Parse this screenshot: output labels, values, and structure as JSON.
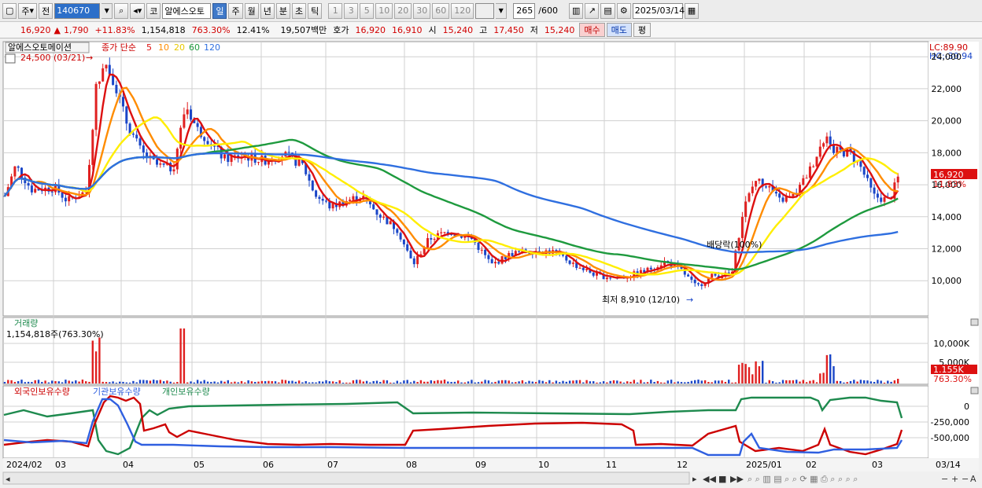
{
  "toolbar": {
    "type_label": "주",
    "prev_label": "전",
    "code": "140670",
    "market_label": "코",
    "stock_name": "알에스오토",
    "periods": [
      "일",
      "주",
      "월",
      "년",
      "분",
      "초",
      "틱"
    ],
    "active_period": "일",
    "intervals": [
      "1",
      "3",
      "5",
      "10",
      "20",
      "30",
      "60",
      "120"
    ],
    "count": "265",
    "count_total": "/600",
    "date": "2025/03/14"
  },
  "quote": {
    "price": "16,920",
    "change_arrow": "▲",
    "change": "1,790",
    "change_pct": "+11.83%",
    "volume": "1,154,818",
    "volume_ratio": "763.30%",
    "turnover_ratio": "12.41%",
    "trade_value": "19,507백만",
    "ask_label": "호가",
    "ask": "16,920",
    "bid": "16,910",
    "open_label": "시",
    "open": "15,240",
    "high_label": "고",
    "high": "17,450",
    "low_label": "저",
    "low": "15,240",
    "buy_label": "매수",
    "sell_label": "매도",
    "flat_label": "평"
  },
  "price_pane": {
    "stock_tag": "알에스오토메이션",
    "ma_title": "종가 단순",
    "ma_periods": [
      "5",
      "10",
      "20",
      "60",
      "120"
    ],
    "ma_colors": [
      "#dd1010",
      "#ff8c00",
      "#ffee00",
      "#1e9a3e",
      "#2f6fe0"
    ],
    "high_marker": "24,500 (03/21)",
    "low_marker": "최저 8,910 (12/10)",
    "dividend_marker": "배당락(100%)",
    "lc_label": "LC:89.90",
    "hc_label": "HC:-30.94",
    "current_price": "16,920",
    "current_change": "11.83%",
    "y_labels": [
      "24,000",
      "22,000",
      "20,000",
      "18,000",
      "16,000",
      "14,000",
      "12,000",
      "10,000"
    ]
  },
  "volume_pane": {
    "title": "거래량",
    "value": "1,154,818주(763.30%)",
    "current": "1.155K",
    "current_pct": "763.30%",
    "y_labels": [
      "10,000K",
      "5,000K"
    ]
  },
  "holding_pane": {
    "legend": [
      "외국인보유수량",
      "기관보유수량",
      "개인보유수량"
    ],
    "legend_colors": [
      "#cc0000",
      "#2f5fe0",
      "#1e8a4e"
    ],
    "y_labels": [
      "0",
      "-250,000",
      "-500,000"
    ]
  },
  "x_axis": {
    "labels": [
      "2024/02",
      "03",
      "04",
      "05",
      "06",
      "07",
      "08",
      "09",
      "10",
      "11",
      "12",
      "2025/01",
      "02",
      "03"
    ],
    "last_date": "03/14"
  },
  "colors": {
    "up": "#e02020",
    "down": "#1a46c8",
    "grid": "#d0d0d0",
    "active_tab": "#3f79c9"
  }
}
